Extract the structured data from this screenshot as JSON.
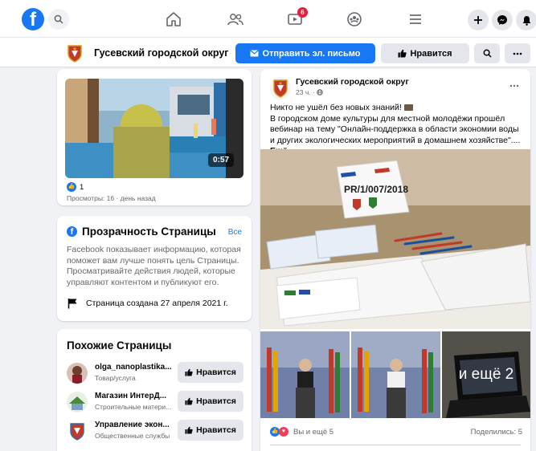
{
  "topbar": {
    "logo_letter": "f",
    "notification_count": "6"
  },
  "page_header": {
    "page_name": "Гусевский городской округ",
    "send_email_label": "Отправить эл. письмо",
    "like_label": "Нравится"
  },
  "video_card": {
    "duration": "0:57",
    "reaction_count": "1",
    "views_meta": "Просмотры: 16 · день назад"
  },
  "transparency": {
    "title": "Прозрачность Страницы",
    "see_all": "Все",
    "description": "Facebook показывает информацию, которая поможет вам лучше понять цель Страницы. Просматривайте действия людей, которые управляют контентом и публикуют его.",
    "created": "Страница создана 27 апреля 2021 г."
  },
  "similar": {
    "title": "Похожие Страницы",
    "items": [
      {
        "name": "olga_nanoplastika...",
        "category": "Товар/услуга",
        "button": "Нравится"
      },
      {
        "name": "Магазин ИнтерД...",
        "category": "Строительные матери...",
        "button": "Нравится"
      },
      {
        "name": "Управление экон...",
        "category": "Общественные службы",
        "button": "Нравится"
      }
    ]
  },
  "post": {
    "author": "Гусевский городской округ",
    "time": "23 ч. · ",
    "text_line1": "Никто не ушёл без новых знаний! ",
    "text_body": "В городском доме культуры для местной молодёжи прошёл вебинар на тему \"Онлайн-поддержка в области экономии воды и других экологических мероприятий в домашнем хозяйстве\"....",
    "see_more": "Ещё",
    "photo_sign": "PR/1/007/2018",
    "more_photos": "и ещё 2",
    "reactions_text": "Вы и ещё 5",
    "shares": "Поделились: 5"
  },
  "colors": {
    "brand": "#1877f2",
    "background": "#f0f2f5",
    "notification": "#e41e3f"
  }
}
